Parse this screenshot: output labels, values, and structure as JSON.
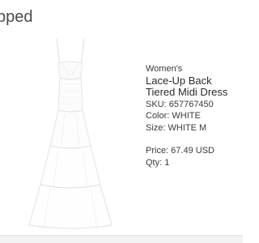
{
  "header": {
    "title": "pped"
  },
  "product": {
    "image_icon": "dress-image",
    "category": "Women's",
    "name": "Lace-Up Back Tiered Midi Dress",
    "sku": "SKU: 657767450",
    "color": "Color: WHITE",
    "size": "Size: WHITE M",
    "price": "Price: 67.49 USD",
    "qty": "Qty: 1"
  }
}
